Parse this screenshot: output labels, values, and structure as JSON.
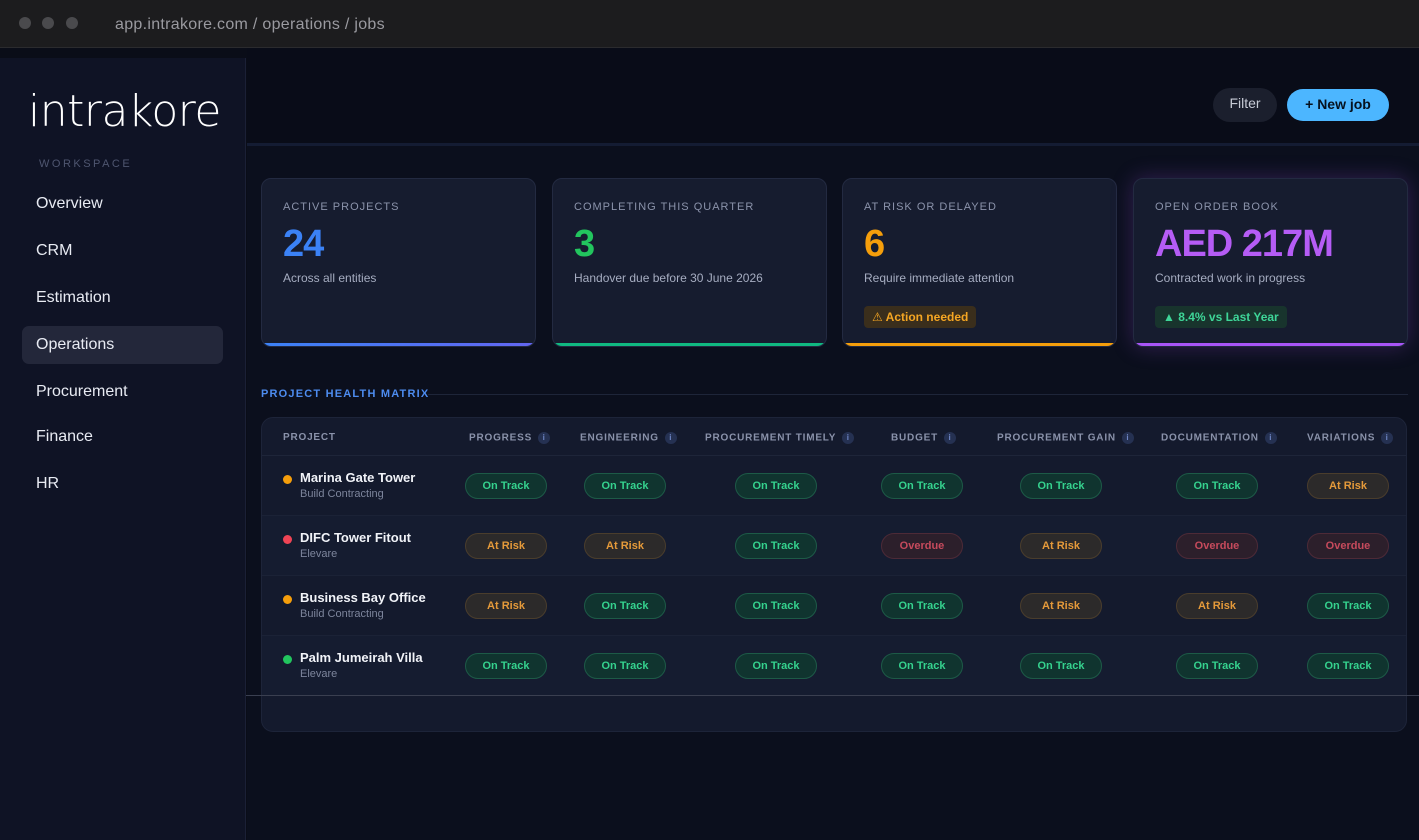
{
  "window": {
    "url": "app.intrakore.com / operations / jobs"
  },
  "sidebar": {
    "logo": "intrakore",
    "section_label": "WORKSPACE",
    "items": [
      {
        "label": "Overview"
      },
      {
        "label": "CRM"
      },
      {
        "label": "Estimation"
      },
      {
        "label": "Operations",
        "active": true
      },
      {
        "label": "Procurement"
      },
      {
        "label": "Finance"
      },
      {
        "label": "HR"
      }
    ]
  },
  "toolbar": {
    "filter_label": "Filter",
    "new_job_label": "+ New job"
  },
  "kpis": [
    {
      "label": "ACTIVE PROJECTS",
      "value": "24",
      "sub": "Across all entities",
      "color": "#3b82f6"
    },
    {
      "label": "COMPLETING THIS QUARTER",
      "value": "3",
      "sub": "Handover due before 30 June 2026",
      "color": "#22c55e"
    },
    {
      "label": "AT RISK OR DELAYED",
      "value": "6",
      "sub": "Require immediate attention",
      "badge": "⚠ Action needed",
      "color": "#f59e0b"
    },
    {
      "label": "OPEN ORDER BOOK",
      "value": "AED 217M",
      "sub": "Contracted work in progress",
      "badge": "▲ 8.4% vs Last Year",
      "color": "#a855f7"
    }
  ],
  "matrix": {
    "title": "PROJECT HEALTH MATRIX",
    "columns": [
      "PROJECT",
      "PROGRESS",
      "ENGINEERING",
      "PROCUREMENT TIMELY",
      "BUDGET",
      "PROCUREMENT GAIN",
      "DOCUMENTATION",
      "VARIATIONS"
    ],
    "rows": [
      {
        "name": "Marina Gate Tower",
        "entity": "Build Contracting",
        "dot": "#f59e0b",
        "cells": [
          "On Track",
          "On Track",
          "On Track",
          "On Track",
          "On Track",
          "On Track",
          "At Risk"
        ]
      },
      {
        "name": "DIFC Tower Fitout",
        "entity": "Elevare",
        "dot": "#ef4455",
        "cells": [
          "At Risk",
          "At Risk",
          "On Track",
          "Overdue",
          "At Risk",
          "Overdue",
          "Overdue"
        ]
      },
      {
        "name": "Business Bay Office",
        "entity": "Build Contracting",
        "dot": "#f59e0b",
        "cells": [
          "At Risk",
          "On Track",
          "On Track",
          "On Track",
          "At Risk",
          "At Risk",
          "On Track"
        ]
      },
      {
        "name": "Palm Jumeirah Villa",
        "entity": "Elevare",
        "dot": "#22c55e",
        "cells": [
          "On Track",
          "On Track",
          "On Track",
          "On Track",
          "On Track",
          "On Track",
          "On Track"
        ]
      }
    ]
  }
}
